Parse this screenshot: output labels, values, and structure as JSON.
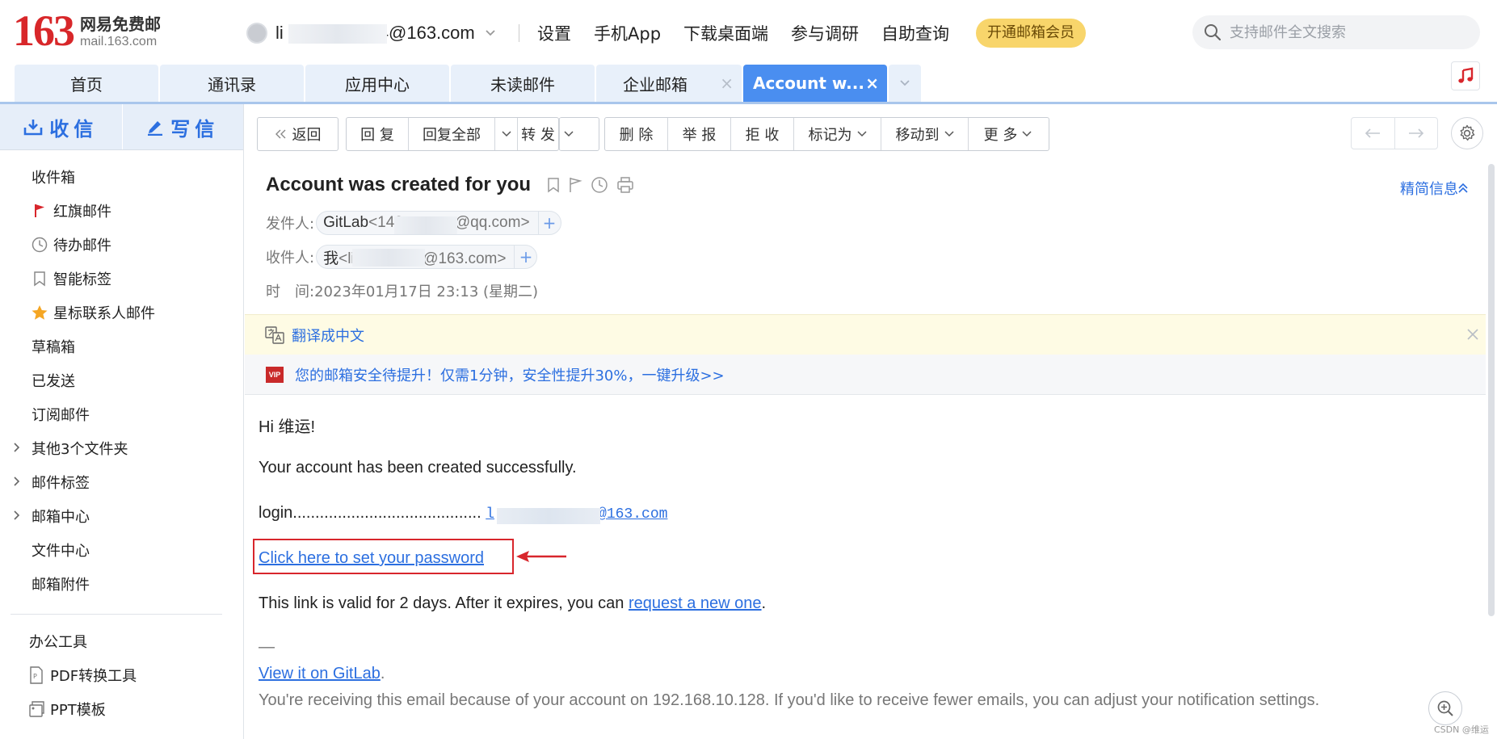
{
  "app": {
    "logo_number": "163",
    "logo_cn": "网易免费邮",
    "logo_en": "mail.163.com"
  },
  "account": {
    "email_prefix": "li",
    "email_suffix": "4@163.com"
  },
  "top_nav": [
    "设置",
    "手机App",
    "下载桌面端",
    "参与调研",
    "自助查询"
  ],
  "vip_button": "开通邮箱会员",
  "search": {
    "placeholder": "支持邮件全文搜索"
  },
  "tabs": [
    {
      "label": "首页"
    },
    {
      "label": "通讯录"
    },
    {
      "label": "应用中心"
    },
    {
      "label": "未读邮件"
    },
    {
      "label": "企业邮箱"
    },
    {
      "label": "Account w..."
    }
  ],
  "sidebar": {
    "receive": "收信",
    "compose": "写信",
    "items": [
      "收件箱",
      "红旗邮件",
      "待办邮件",
      "智能标签",
      "星标联系人邮件",
      "草稿箱",
      "已发送",
      "订阅邮件",
      "其他3个文件夹",
      "邮件标签",
      "邮箱中心",
      "文件中心",
      "邮箱附件"
    ],
    "tools_title": "办公工具",
    "tools": [
      "PDF转换工具",
      "PPT模板"
    ]
  },
  "toolbar": {
    "back": "返回",
    "reply": "回 复",
    "reply_all": "回复全部",
    "forward": "转 发",
    "delete": "删 除",
    "report": "举 报",
    "reject": "拒 收",
    "mark_as": "标记为",
    "move_to": "移动到",
    "more": "更 多"
  },
  "mail": {
    "subject": "Account was created for you",
    "simple_info": "精简信息",
    "from_label": "发件人:",
    "from_name": "GitLab",
    "from_addr_prefix": "<142",
    "from_addr_suffix": "@qq.com>",
    "to_label": "收件人:",
    "to_name": "我",
    "to_addr_prefix": "<li",
    "to_addr_suffix": "4@163.com>",
    "time_label": "时　间:",
    "time_value": "2023年01月17日 23:13 (星期二)",
    "translate_text": "翻译成中文",
    "upgrade_text": "您的邮箱安全待提升！仅需1分钟，安全性提升30%，一键升级>>",
    "vip_badge": "VIP",
    "body": {
      "greeting": "Hi 维运!",
      "created": "Your account has been created successfully.",
      "login_label": "login..........................................",
      "login_prefix": "l",
      "login_suffix": "@163.com",
      "set_password": "Click here to set your password",
      "valid_text": "This link is valid for 2 days. After it expires, you can",
      "request_link": "request a new one",
      "period": ".",
      "dash": "—",
      "view_gitlab": "View it on GitLab",
      "footer": "You're receiving this email because of your account on 192.168.10.128. If you'd like to receive fewer emails, you can adjust your notification settings."
    }
  },
  "watermark": "CSDN @维运",
  "colors": {
    "accent": "#2c6fe0",
    "tab_active": "#4a8ef0",
    "logo_red": "#d8272a",
    "vip_yellow": "#f8d56b",
    "annotation_red": "#d8262c"
  }
}
